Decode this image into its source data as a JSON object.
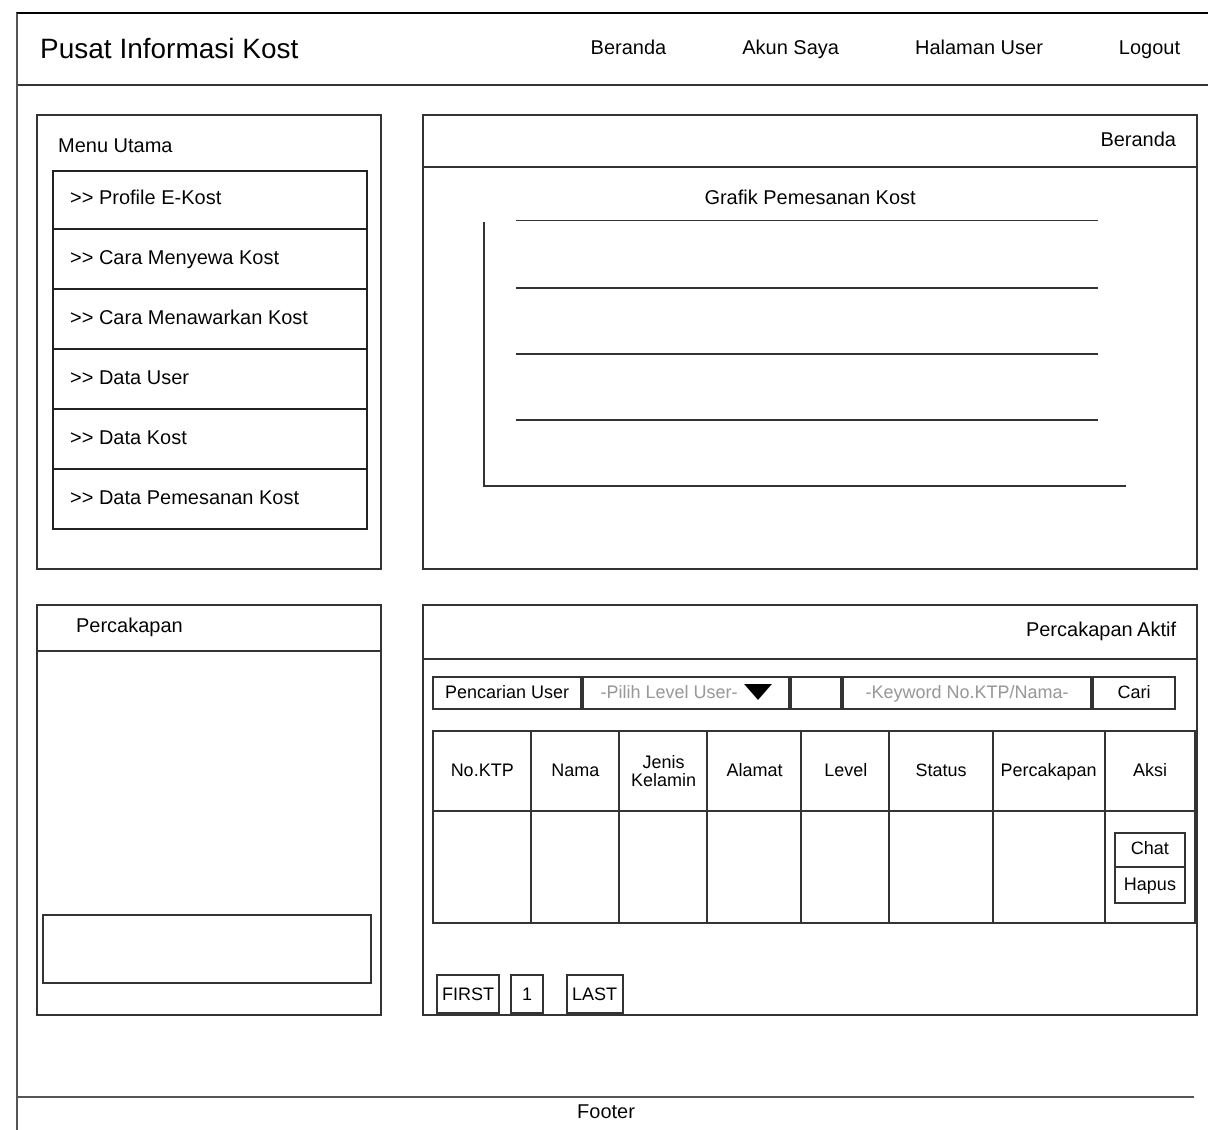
{
  "header": {
    "title": "Pusat Informasi Kost",
    "nav": [
      {
        "label": "Beranda"
      },
      {
        "label": "Akun Saya"
      },
      {
        "label": "Halaman User"
      },
      {
        "label": "Logout"
      }
    ]
  },
  "menu": {
    "title": "Menu Utama",
    "items": [
      {
        "label": ">> Profile E-Kost"
      },
      {
        "label": ">> Cara Menyewa Kost"
      },
      {
        "label": ">> Cara Menawarkan Kost"
      },
      {
        "label": ">> Data User"
      },
      {
        "label": ">> Data Kost"
      },
      {
        "label": ">> Data Pemesanan Kost"
      }
    ]
  },
  "beranda": {
    "title": "Beranda",
    "chart_title": "Grafik Pemesanan Kost"
  },
  "percakapan": {
    "title": "Percakapan"
  },
  "percakapan_aktif": {
    "title": "Percakapan Aktif",
    "search": {
      "label": "Pencarian User",
      "level_placeholder": "-Pilih Level User-",
      "keyword_placeholder": "-Keyword No.KTP/Nama-",
      "button": "Cari"
    },
    "table": {
      "columns": [
        "No.KTP",
        "Nama",
        "Jenis Kelamin",
        "Alamat",
        "Level",
        "Status",
        "Percakapan",
        "Aksi"
      ],
      "actions": [
        "Chat",
        "Hapus"
      ]
    },
    "pagination": [
      "FIRST",
      "1",
      "LAST"
    ]
  },
  "footer": "Footer"
}
